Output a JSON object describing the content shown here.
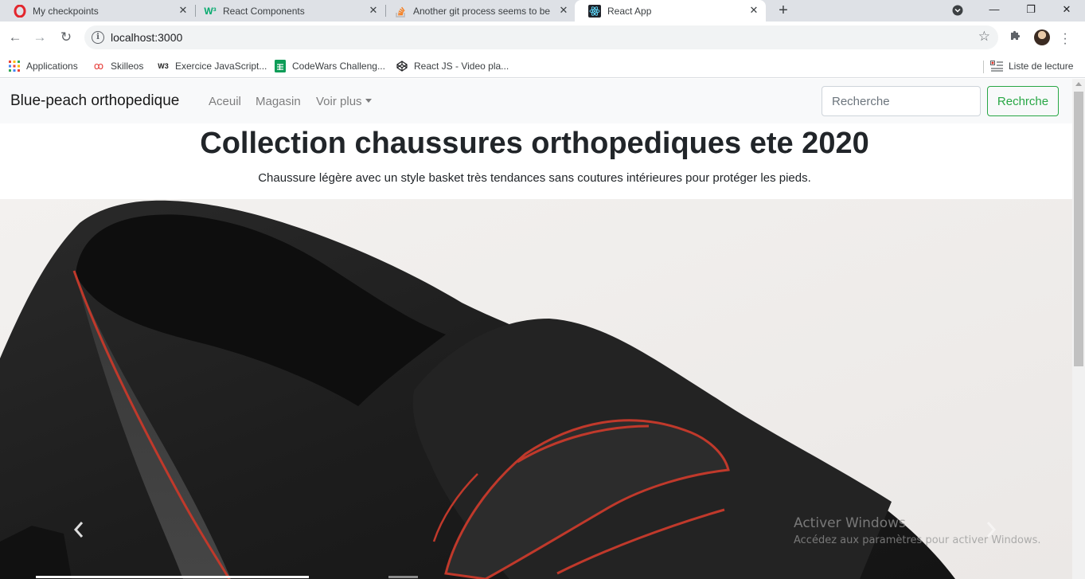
{
  "browser": {
    "tabs": [
      {
        "title": "My checkpoints",
        "icon": "opera-o-icon",
        "active": false
      },
      {
        "title": "React Components",
        "icon": "w3schools-icon",
        "active": false
      },
      {
        "title": "Another git process seems to be",
        "icon": "stackoverflow-icon",
        "active": false
      },
      {
        "title": "React App",
        "icon": "react-icon",
        "active": true
      }
    ],
    "new_tab": "+",
    "url": "localhost:3000",
    "bookmarks": [
      {
        "label": "Applications",
        "icon": "apps-grid-icon"
      },
      {
        "label": "Skilleos",
        "icon": "skilleos-icon"
      },
      {
        "label": "Exercice JavaScript...",
        "icon": "w3-icon"
      },
      {
        "label": "CodeWars Challeng...",
        "icon": "sheets-icon"
      },
      {
        "label": "React JS - Video pla...",
        "icon": "codepen-icon"
      }
    ],
    "reading_list": "Liste de lecture"
  },
  "navbar": {
    "brand": "Blue-peach orthopedique",
    "links": [
      "Aceuil",
      "Magasin",
      "Voir plus"
    ],
    "search_placeholder": "Recherche",
    "search_button": "Rechrche",
    "accent": "#28a745"
  },
  "hero": {
    "title": "Collection chaussures orthopediques ete 2020",
    "subtitle": "Chaussure légère avec un style basket très tendances sans coutures intérieures pour protéger les pieds."
  },
  "carousel": {
    "image": "black-suede-shoe-red-piping",
    "prev_icon": "chevron-left-icon",
    "next_icon": "chevron-right-icon"
  },
  "watermark": {
    "line1": "Activer Windows",
    "line2": "Accédez aux paramètres pour activer Windows."
  }
}
